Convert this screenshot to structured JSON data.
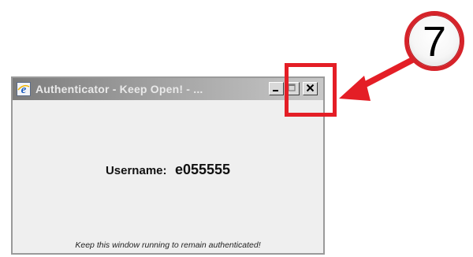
{
  "window": {
    "title": "Authenticator - Keep Open! - ..."
  },
  "content": {
    "username_label": "Username:",
    "username_value": "e055555",
    "footer_note": "Keep this window running to remain authenticated!"
  },
  "callout": {
    "step_number": "7",
    "color": "#e41e26"
  },
  "icons": {
    "app_icon": "internet-explorer-icon",
    "minimize": "minimize-icon",
    "maximize": "maximize-icon",
    "close": "close-icon"
  }
}
